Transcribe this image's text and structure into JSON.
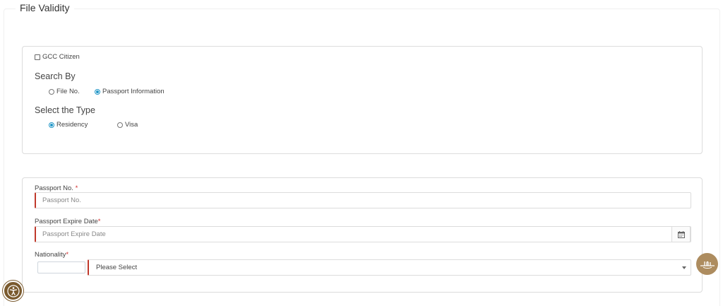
{
  "page": {
    "title": "File Validity"
  },
  "gcc": {
    "label": "GCC Citizen"
  },
  "search_by": {
    "label": "Search By",
    "options": [
      {
        "label": "File No.",
        "checked": false
      },
      {
        "label": "Passport Information",
        "checked": true
      }
    ]
  },
  "type": {
    "label": "Select the Type",
    "options": [
      {
        "label": "Residency",
        "checked": true
      },
      {
        "label": "Visa",
        "checked": false
      }
    ]
  },
  "passport_no": {
    "label": "Passport No.",
    "required_mark": "*",
    "placeholder": "Passport No."
  },
  "passport_expiry": {
    "label": "Passport Expire Date",
    "required_mark": "*",
    "placeholder": "Passport Expire Date"
  },
  "nationality": {
    "label": "Nationality",
    "required_mark": "*",
    "selected": "Please Select"
  },
  "icons": {
    "calendar": "calendar-icon",
    "dropdown": "chevron-down-icon",
    "brand": "brand-logo-icon",
    "accessibility": "accessibility-icon"
  },
  "colors": {
    "required": "#c0392b",
    "radio_checked": "#2196c7",
    "brand": "#ad8c5f",
    "accessibility": "#7a5a2e"
  }
}
